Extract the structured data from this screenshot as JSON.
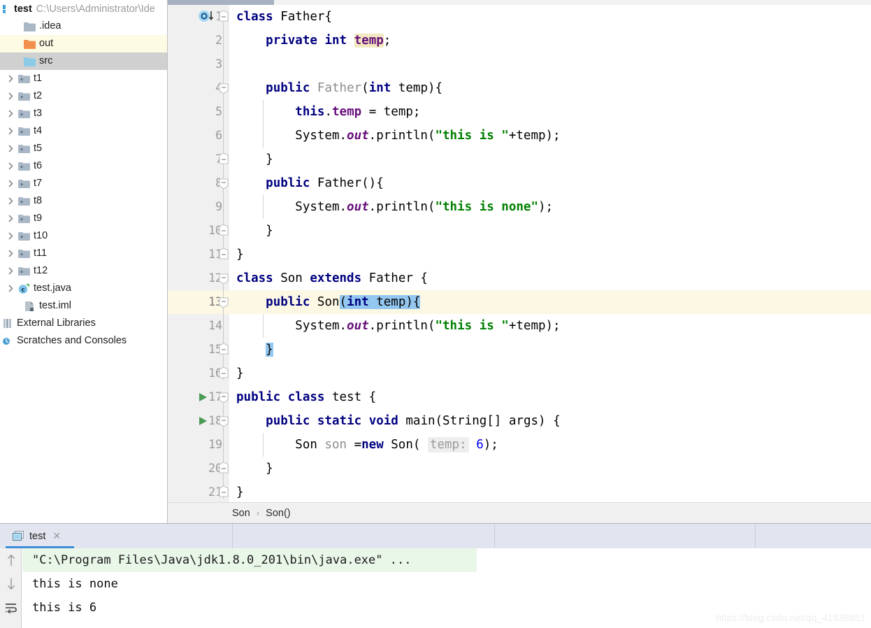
{
  "project": {
    "root_name": "test",
    "root_path": "C:\\Users\\Administrator\\Ide",
    "items": [
      {
        "label": ".idea",
        "icon": "folder-gray-icon",
        "arrow": false,
        "indent": 1,
        "state": "none"
      },
      {
        "label": "out",
        "icon": "folder-orange-icon",
        "arrow": false,
        "indent": 1,
        "state": "yellow"
      },
      {
        "label": "src",
        "icon": "folder-blue-icon",
        "arrow": false,
        "indent": 1,
        "state": "gray"
      },
      {
        "label": "t1",
        "icon": "package-icon",
        "arrow": true,
        "indent": 2,
        "state": "none"
      },
      {
        "label": "t2",
        "icon": "package-icon",
        "arrow": true,
        "indent": 2,
        "state": "none"
      },
      {
        "label": "t3",
        "icon": "package-icon",
        "arrow": true,
        "indent": 2,
        "state": "none"
      },
      {
        "label": "t4",
        "icon": "package-icon",
        "arrow": true,
        "indent": 2,
        "state": "none"
      },
      {
        "label": "t5",
        "icon": "package-icon",
        "arrow": true,
        "indent": 2,
        "state": "none"
      },
      {
        "label": "t6",
        "icon": "package-icon",
        "arrow": true,
        "indent": 2,
        "state": "none"
      },
      {
        "label": "t7",
        "icon": "package-icon",
        "arrow": true,
        "indent": 2,
        "state": "none"
      },
      {
        "label": "t8",
        "icon": "package-icon",
        "arrow": true,
        "indent": 2,
        "state": "none"
      },
      {
        "label": "t9",
        "icon": "package-icon",
        "arrow": true,
        "indent": 2,
        "state": "none"
      },
      {
        "label": "t10",
        "icon": "package-icon",
        "arrow": true,
        "indent": 2,
        "state": "none"
      },
      {
        "label": "t11",
        "icon": "package-icon",
        "arrow": true,
        "indent": 2,
        "state": "none"
      },
      {
        "label": "t12",
        "icon": "package-icon",
        "arrow": true,
        "indent": 2,
        "state": "none"
      },
      {
        "label": "test.java",
        "icon": "java-class-icon",
        "arrow": true,
        "indent": 2,
        "state": "none"
      },
      {
        "label": "test.iml",
        "icon": "iml-file-icon",
        "arrow": false,
        "indent": 1,
        "state": "none"
      },
      {
        "label": "External Libraries",
        "icon": "library-icon",
        "arrow": false,
        "indent": 0,
        "state": "none"
      },
      {
        "label": "Scratches and Consoles",
        "icon": "scratches-icon",
        "arrow": false,
        "indent": 0,
        "state": "none"
      }
    ]
  },
  "editor": {
    "current_line": 13,
    "total_lines": 21,
    "line_numbers": [
      "1",
      "2",
      "3",
      "4",
      "5",
      "6",
      "7",
      "8",
      "9",
      "10",
      "11",
      "12",
      "13",
      "14",
      "15",
      "16",
      "17",
      "18",
      "19",
      "20",
      "21"
    ],
    "code_lines": [
      "class Father{",
      "    private int temp;",
      "",
      "    public Father(int temp){",
      "        this.temp = temp;",
      "        System.out.println(\"this is \"+temp);",
      "    }",
      "    public Father(){",
      "        System.out.println(\"this is none\");",
      "    }",
      "}",
      "class Son extends Father {",
      "    public Son(int temp){",
      "        System.out.println(\"this is \"+temp);",
      "    }",
      "}",
      "public class test {",
      "    public static void main(String[] args) {",
      "        Son son =new Son( temp: 6);",
      "    }",
      "}"
    ],
    "parameter_hint": "temp:",
    "gutter_icons": {
      "line1": "implemented-by-icon",
      "line17": "run-class-icon",
      "line18": "run-method-icon"
    }
  },
  "breadcrumb": {
    "items": [
      "Son",
      "Son()"
    ],
    "separator": "›"
  },
  "run_panel": {
    "tab_label": "test",
    "tab_icon": "console-icon",
    "close_icon": "close-icon",
    "toolbar_icons": [
      "arrow-up-icon",
      "arrow-down-icon",
      "soft-wrap-icon"
    ],
    "output": [
      {
        "text": "\"C:\\Program Files\\Java\\jdk1.8.0_201\\bin\\java.exe\" ...",
        "style": "cmd"
      },
      {
        "text": "this is none",
        "style": "plain"
      },
      {
        "text": "this is 6",
        "style": "plain"
      }
    ]
  },
  "watermark": {
    "text": "https://blog.csdn.net/qq_41638851"
  },
  "colors": {
    "keyword": "#000080",
    "string": "#008000",
    "number": "#0000ff",
    "field": "#660e7a",
    "current_line_bg": "#fdf8e3",
    "selection_bg": "#d0d0d0",
    "brace_match_bg": "#93c7f0",
    "console_cmd_bg": "#e9f7e9",
    "accent": "#3f8cd8"
  }
}
